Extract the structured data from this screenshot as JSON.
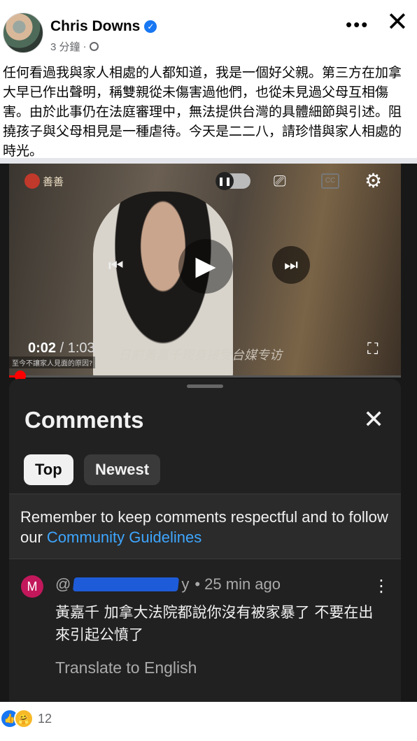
{
  "post": {
    "author": "Chris Downs",
    "time": "3 分鐘",
    "separator": "·",
    "text": "任何看過我與家人相處的人都知道，我是一個好父親。第三方在加拿大早已作出聲明，稱雙親從未傷害過他們，也從未見過父母互相傷害。由於此事仍在法庭審理中，無法提供台灣的具體細節與引述。阻撓孩子與父母相見是一種虐待。今天是二二八，請珍惜與家人相處的時光。",
    "icons": [
      "verified-badge-icon",
      "globe-icon",
      "more-dots-icon",
      "close-icon"
    ]
  },
  "video": {
    "current_time": "0:02",
    "duration": "/ 1:03",
    "subtitle": "日前黃嘉千现身接受台媒专访",
    "caption_small": "至今不讓家人見面的原因?",
    "logo_text": "善善",
    "progress_fraction": 0.03
  },
  "comments_sheet": {
    "title": "Comments",
    "chip_top": "Top",
    "chip_newest": "Newest",
    "notice_text": "Remember to keep comments respectful and to follow our ",
    "notice_link": "Community Guidelines",
    "comment": {
      "avatar_letter": "M",
      "handle_prefix": "@",
      "handle_suffix": "y",
      "time": "• 25 min ago",
      "body": "黃嘉千 加拿大法院都說你沒有被家暴了 不要在出來引起公憤了",
      "translate": "Translate to English"
    }
  },
  "reactions": {
    "count": "12",
    "icons": [
      "like-icon",
      "care-icon"
    ]
  }
}
